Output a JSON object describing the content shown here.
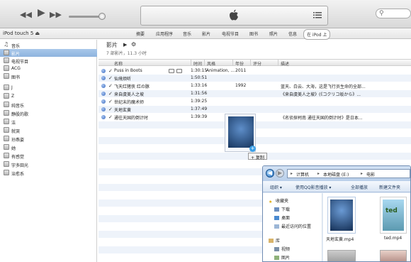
{
  "toolbar": {
    "rewind_icon": "rewind-icon",
    "play_icon": "play-icon",
    "forward_icon": "fast-forward-icon",
    "apple_icon": "apple-logo-icon",
    "list_icon": "list-view-icon",
    "search_icon": "search-icon"
  },
  "nav": {
    "device_name": "iPod touch 5",
    "device_eject": "⏏",
    "tabs": [
      "摘要",
      "应用程序",
      "音乐",
      "影片",
      "电视节目",
      "图书",
      "照片",
      "信息"
    ],
    "active_tab": "在 iPod 上"
  },
  "sidebar": {
    "items": [
      {
        "label": "音乐",
        "icon": "music-note-icon"
      },
      {
        "label": "影片",
        "icon": "movie-icon",
        "selected": true
      },
      {
        "label": "电视节目",
        "icon": "tv-icon"
      },
      {
        "label": "ACG",
        "icon": "playlist-icon"
      },
      {
        "label": "图书",
        "icon": "book-icon"
      },
      {
        "label": "J",
        "icon": "playlist-icon"
      },
      {
        "label": "Z",
        "icon": "playlist-icon"
      },
      {
        "label": "纯音乐",
        "icon": "playlist-icon"
      },
      {
        "label": "静股的歌",
        "icon": "playlist-icon"
      },
      {
        "label": "洁",
        "icon": "playlist-icon"
      },
      {
        "label": "就哭",
        "icon": "playlist-icon"
      },
      {
        "label": "孙燕姿",
        "icon": "playlist-icon"
      },
      {
        "label": "她",
        "icon": "playlist-icon"
      },
      {
        "label": "有感觉",
        "icon": "playlist-icon"
      },
      {
        "label": "宇多田光",
        "icon": "playlist-icon"
      },
      {
        "label": "治愈系",
        "icon": "playlist-icon"
      }
    ]
  },
  "content": {
    "title": "影片",
    "play_glyph": "▶",
    "gear_glyph": "⚙",
    "subtitle": "7 部影片，11.3 小时"
  },
  "table": {
    "headers": [
      "名称",
      "时间",
      "风格",
      "年份",
      "评分",
      "描述"
    ],
    "rows": [
      {
        "name": "Puss in Boots",
        "time": "1:30:15",
        "genre": "Animation, ...",
        "year": "2011",
        "desc": ""
      },
      {
        "name": "仙境烦听",
        "time": "1:50:51",
        "genre": "",
        "year": "",
        "desc": ""
      },
      {
        "name": "飞天红猪侠 红の豚",
        "time": "1:33:16",
        "genre": "",
        "year": "1992",
        "desc": "蓝天、白云、大海，这是飞行员生命的全部..."
      },
      {
        "name": "来自虞美人之坡",
        "time": "1:31:56",
        "genre": "",
        "year": "",
        "desc": "《来自虞美人之坡》(《コクリコ坂から》..."
      },
      {
        "name": "世纪末的魔术师",
        "time": "1:39:25",
        "genre": "",
        "year": "",
        "desc": ""
      },
      {
        "name": "天地玄黄",
        "time": "1:37:49",
        "genre": "",
        "year": "",
        "desc": ""
      },
      {
        "name": "通往天国的倒计时",
        "time": "1:39:39",
        "genre": "",
        "year": "",
        "desc": "《名侦探柯南 通往天国的倒计时》是日本..."
      }
    ]
  },
  "drag": {
    "copy_label": "+ 复制",
    "plus_glyph": "+"
  },
  "explorer": {
    "back_glyph": "◀",
    "fwd_glyph": "▶",
    "crumbs": [
      "计算机",
      "本地磁盘 (E:)",
      "电影"
    ],
    "toolbar": [
      "组织 ▾",
      "使用QQ影音播放 ▾",
      "全部播放",
      "新建文件夹"
    ],
    "nav_items": [
      "收藏夹",
      "下载",
      "桌面",
      "最近访问的位置",
      "库",
      "视频",
      "图片"
    ],
    "files": [
      "天地玄黄.mp4",
      "ted.mp4"
    ]
  }
}
